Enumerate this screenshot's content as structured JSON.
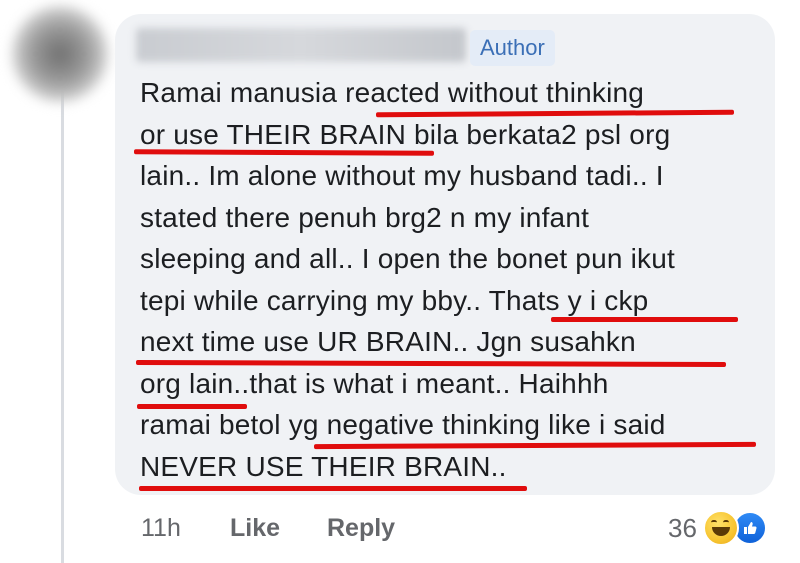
{
  "comment": {
    "badge": "Author",
    "lines": [
      "Ramai manusia reacted without thinking",
      "or use THEIR BRAIN bila berkata2 psl org",
      "lain.. Im alone without my husband tadi.. I",
      "stated there penuh brg2 n my infant",
      "sleeping and all.. I open the bonet pun ikut",
      "tepi  while carrying my bby.. Thats y i ckp",
      "next time use UR BRAIN.. Jgn susahkn",
      "org lain..that is what i meant.. Haihhh",
      "ramai betol yg negative thinking like i said",
      "NEVER USE THEIR BRAIN.."
    ]
  },
  "actions": {
    "time": "11h",
    "like_label": "Like",
    "reply_label": "Reply"
  },
  "reactions": {
    "count": "36",
    "icons": [
      "haha-icon",
      "like-icon"
    ],
    "like_color": "#1877f2",
    "haha_color": "#f7c531"
  },
  "colors": {
    "underline": "#e00d0d",
    "badge_text": "#3b6fb6",
    "bubble": "#f0f2f5"
  }
}
